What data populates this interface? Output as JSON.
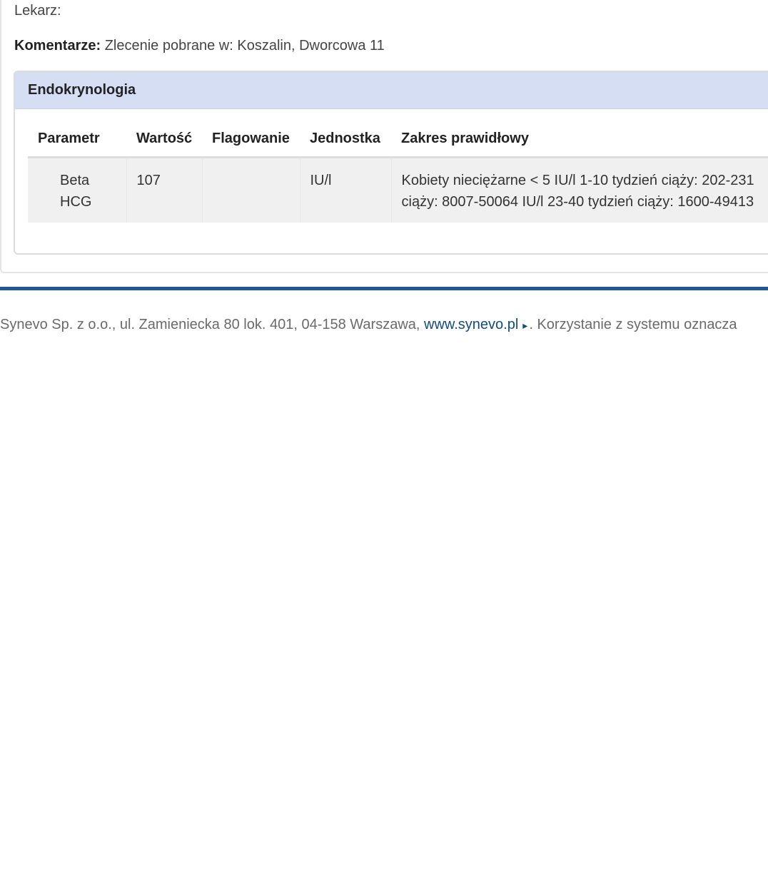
{
  "doctor": {
    "label": "Lekarz:"
  },
  "comments": {
    "label": "Komentarze:",
    "text": "Zlecenie pobrane w: Koszalin, Dworcowa 11"
  },
  "section": {
    "title": "Endokrynologia",
    "columns": [
      "Parametr",
      "Wartość",
      "Flagowanie",
      "Jednostka",
      "Zakres prawidłowy"
    ],
    "rows": [
      {
        "parameter_line1": "Beta",
        "parameter_line2": "HCG",
        "value": "107",
        "flag": "",
        "unit": "IU/l",
        "range_line1": "Kobiety nieciężarne < 5 IU/l 1-10 tydzień ciąży: 202-231",
        "range_line2": "ciąży: 8007-50064 IU/l 23-40 tydzień ciąży: 1600-49413"
      }
    ]
  },
  "footer": {
    "text": "Synevo Sp. z o.o., ul. Zamieniecka 80 lok. 401, 04-158 Warszawa, ",
    "link": "www.synevo.pl",
    "link_icon": "chevron-right-icon",
    "suffix": ". Korzystanie z systemu oznacza"
  },
  "colors": {
    "section_header_bg": "#d6def3",
    "divider": "#1a5a9a",
    "link": "#0f4c81"
  }
}
